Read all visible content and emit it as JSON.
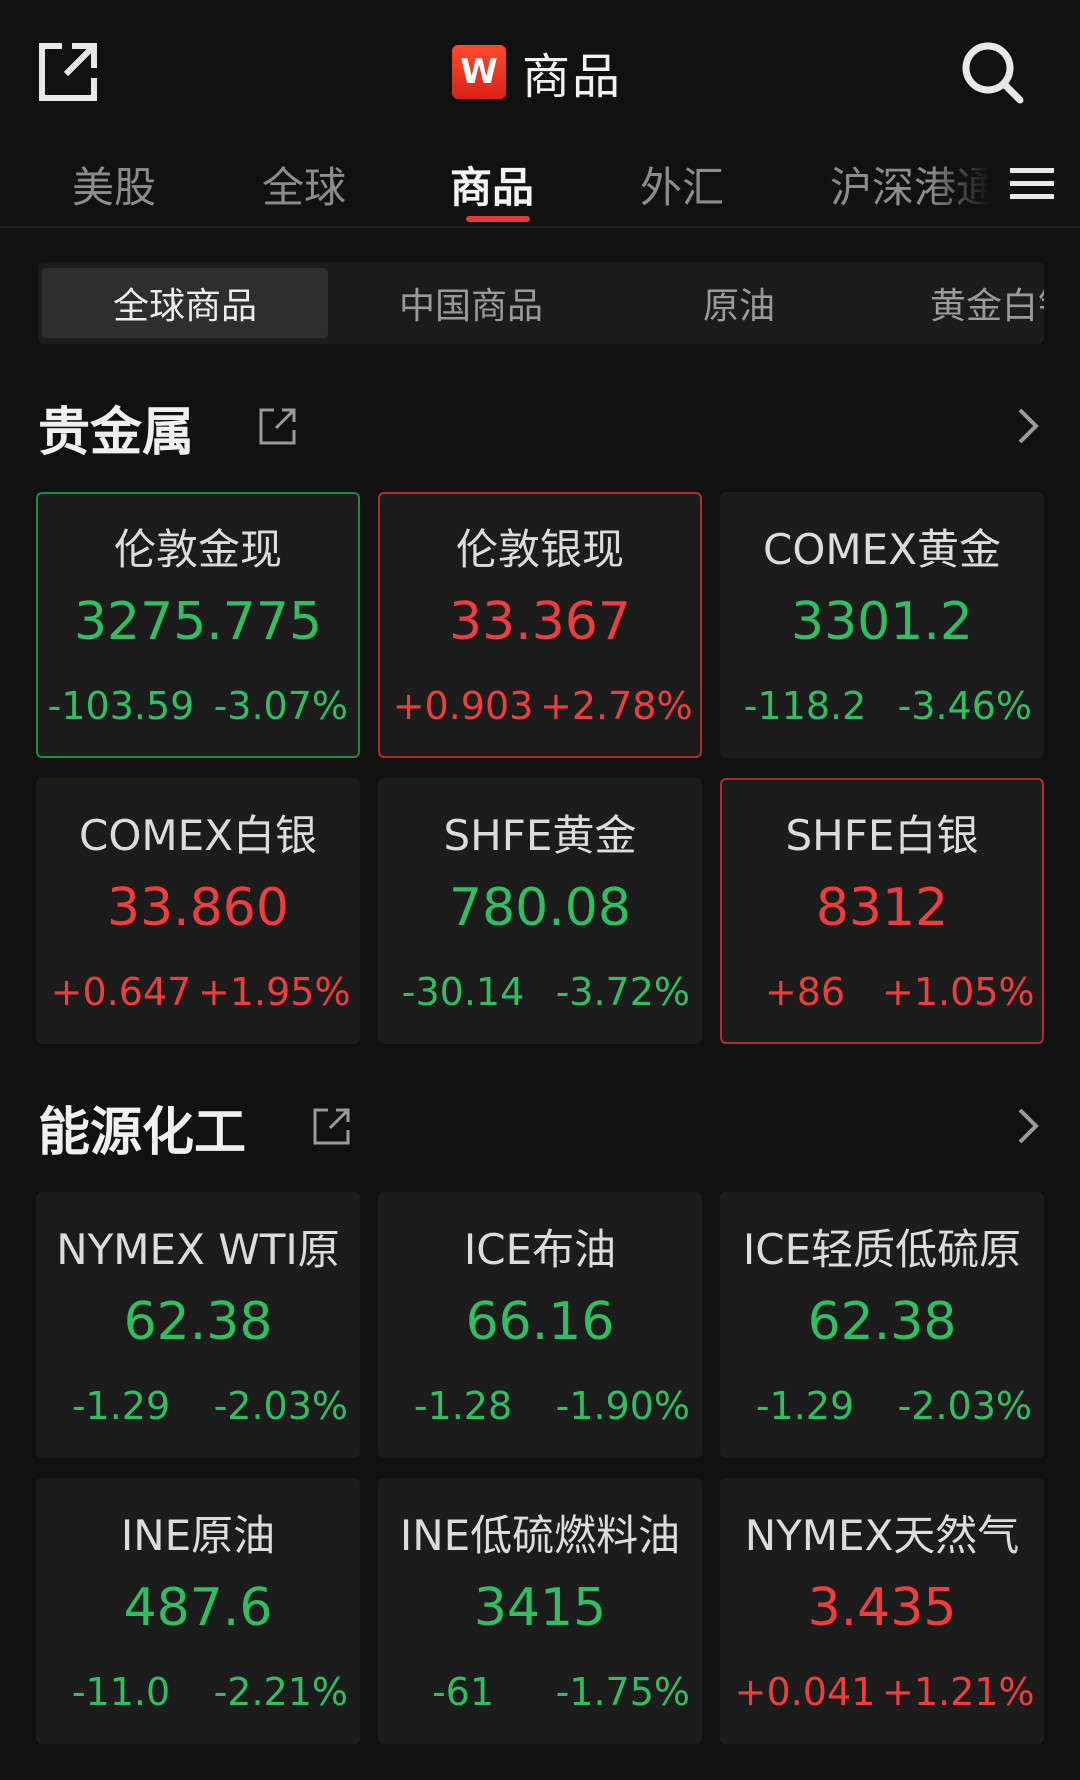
{
  "header": {
    "logo_letter": "W",
    "title": "商品"
  },
  "main_tabs": [
    {
      "label": "美股",
      "active": false
    },
    {
      "label": "全球",
      "active": false
    },
    {
      "label": "商品",
      "active": true
    },
    {
      "label": "外汇",
      "active": false
    },
    {
      "label": "沪深港通",
      "active": false
    }
  ],
  "sub_tabs": [
    {
      "label": "全球商品",
      "active": true
    },
    {
      "label": "中国商品",
      "active": false
    },
    {
      "label": "原油",
      "active": false
    },
    {
      "label": "黄金白银",
      "active": false
    }
  ],
  "sections": [
    {
      "title": "贵金属",
      "items": [
        {
          "name": "伦敦金现",
          "price": "3275.775",
          "change": "-103.59",
          "pct": "-3.07%",
          "dir": "down",
          "highlight": "down"
        },
        {
          "name": "伦敦银现",
          "price": "33.367",
          "change": "+0.903",
          "pct": "+2.78%",
          "dir": "up",
          "highlight": "up"
        },
        {
          "name": "COMEX黄金",
          "price": "3301.2",
          "change": "-118.2",
          "pct": "-3.46%",
          "dir": "down",
          "highlight": "none"
        },
        {
          "name": "COMEX白银",
          "price": "33.860",
          "change": "+0.647",
          "pct": "+1.95%",
          "dir": "up",
          "highlight": "none"
        },
        {
          "name": "SHFE黄金",
          "price": "780.08",
          "change": "-30.14",
          "pct": "-3.72%",
          "dir": "down",
          "highlight": "none"
        },
        {
          "name": "SHFE白银",
          "price": "8312",
          "change": "+86",
          "pct": "+1.05%",
          "dir": "up",
          "highlight": "up"
        }
      ]
    },
    {
      "title": "能源化工",
      "items": [
        {
          "name": "NYMEX WTI原",
          "price": "62.38",
          "change": "-1.29",
          "pct": "-2.03%",
          "dir": "down",
          "highlight": "none"
        },
        {
          "name": "ICE布油",
          "price": "66.16",
          "change": "-1.28",
          "pct": "-1.90%",
          "dir": "down",
          "highlight": "none"
        },
        {
          "name": "ICE轻质低硫原",
          "price": "62.38",
          "change": "-1.29",
          "pct": "-2.03%",
          "dir": "down",
          "highlight": "none"
        },
        {
          "name": "INE原油",
          "price": "487.6",
          "change": "-11.0",
          "pct": "-2.21%",
          "dir": "down",
          "highlight": "none"
        },
        {
          "name": "INE低硫燃料油",
          "price": "3415",
          "change": "-61",
          "pct": "-1.75%",
          "dir": "down",
          "highlight": "none"
        },
        {
          "name": "NYMEX天然气",
          "price": "3.435",
          "change": "+0.041",
          "pct": "+1.21%",
          "dir": "up",
          "highlight": "none"
        }
      ]
    }
  ],
  "colors": {
    "up": "#f03c3c",
    "down": "#2fbf63",
    "accent": "#e23b3b",
    "background": "#111111",
    "card": "#1c1c1c"
  }
}
